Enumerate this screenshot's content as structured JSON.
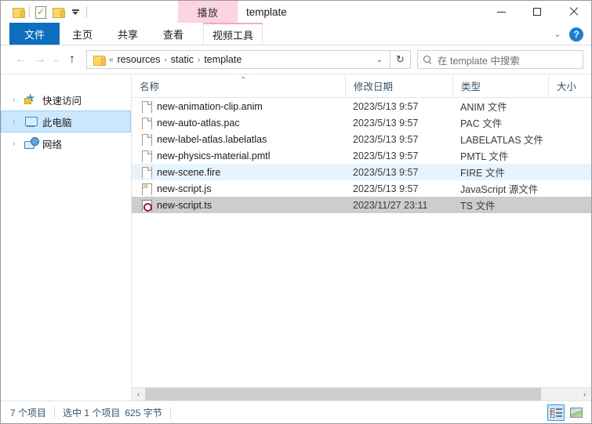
{
  "window": {
    "title": "template",
    "controls": {
      "minimize": "—",
      "maximize": "□",
      "close": "✕"
    }
  },
  "quick_access_toolbar": {
    "items": [
      {
        "name": "folder-properties",
        "icon": "folder-icon"
      },
      {
        "name": "new-folder-check",
        "icon": "document-check-icon"
      },
      {
        "name": "folder",
        "icon": "folder-icon"
      },
      {
        "name": "customize",
        "icon": "caret-down-icon"
      }
    ]
  },
  "ribbon": {
    "contextual_group": "视频工具",
    "contextual_tab": "播放",
    "tabs": [
      {
        "label": "文件",
        "selected": true
      },
      {
        "label": "主页",
        "selected": false
      },
      {
        "label": "共享",
        "selected": false
      },
      {
        "label": "查看",
        "selected": false
      }
    ],
    "collapse_label": "⌄",
    "help_label": "?"
  },
  "address_bar": {
    "back": "←",
    "forward": "→",
    "recent": "⌄",
    "up": "↑",
    "crumb_prefix": "«",
    "crumbs": [
      "resources",
      "static",
      "template"
    ],
    "separator": "›",
    "dropdown": "⌄",
    "refresh": "↻"
  },
  "search": {
    "placeholder": "在 template 中搜索",
    "icon": "search-icon"
  },
  "sidebar": {
    "items": [
      {
        "label": "快速访问",
        "icon": "star-icon",
        "selected": false,
        "chevron": "›"
      },
      {
        "label": "此电脑",
        "icon": "computer-icon",
        "selected": true,
        "chevron": "›"
      },
      {
        "label": "网络",
        "icon": "network-icon",
        "selected": false,
        "chevron": "›"
      }
    ]
  },
  "file_list": {
    "columns": [
      {
        "label": "名称",
        "sorted": true,
        "sort_caret": "⌃"
      },
      {
        "label": "修改日期",
        "sorted": false
      },
      {
        "label": "类型",
        "sorted": false
      },
      {
        "label": "大小",
        "sorted": false
      }
    ],
    "rows": [
      {
        "name": "new-animation-clip.anim",
        "date": "2023/5/13 9:57",
        "type": "ANIM 文件",
        "size": "",
        "icon": "generic-file-icon",
        "state": "normal"
      },
      {
        "name": "new-auto-atlas.pac",
        "date": "2023/5/13 9:57",
        "type": "PAC 文件",
        "size": "",
        "icon": "generic-file-icon",
        "state": "normal"
      },
      {
        "name": "new-label-atlas.labelatlas",
        "date": "2023/5/13 9:57",
        "type": "LABELATLAS 文件",
        "size": "",
        "icon": "generic-file-icon",
        "state": "normal"
      },
      {
        "name": "new-physics-material.pmtl",
        "date": "2023/5/13 9:57",
        "type": "PMTL 文件",
        "size": "",
        "icon": "generic-file-icon",
        "state": "normal"
      },
      {
        "name": "new-scene.fire",
        "date": "2023/5/13 9:57",
        "type": "FIRE 文件",
        "size": "",
        "icon": "generic-file-icon",
        "state": "hover"
      },
      {
        "name": "new-script.js",
        "date": "2023/5/13 9:57",
        "type": "JavaScript 源文件",
        "size": "",
        "icon": "js-file-icon",
        "state": "normal"
      },
      {
        "name": "new-script.ts",
        "date": "2023/11/27 23:11",
        "type": "TS 文件",
        "size": "",
        "icon": "ts-file-icon",
        "state": "selected"
      }
    ]
  },
  "scrollbar": {
    "left_arrow": "‹",
    "right_arrow": "›"
  },
  "status_bar": {
    "item_count": "7 个项目",
    "selection": "选中 1 个项目",
    "selection_size": "625 字节",
    "view_details": "details-view",
    "view_thumbnails": "large-icons-view"
  }
}
